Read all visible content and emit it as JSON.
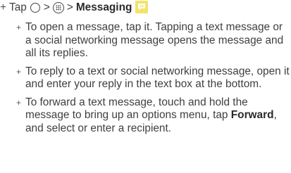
{
  "step": {
    "marker": "+",
    "prefix": "Tap",
    "separator1": ">",
    "separator2": ">",
    "app_name": "Messaging",
    "home_icon": "home-circle-icon",
    "apps_icon": "apps-grid-icon",
    "messaging_icon": "messaging-app-icon",
    "messaging_icon_color": "#f2e36b"
  },
  "bullets": [
    {
      "marker": "+",
      "text": "To open a message, tap it. Tapping a text message or a social networking message opens the message and all its replies."
    },
    {
      "marker": "+",
      "text": "To reply to a text or social networking message, open it and enter your reply in the text box at the bottom."
    },
    {
      "marker": "+",
      "text_before": "To forward a text message, touch and hold the message to bring up an options menu, tap ",
      "bold": "Forward",
      "text_after": ", and select or enter a recipient."
    }
  ]
}
